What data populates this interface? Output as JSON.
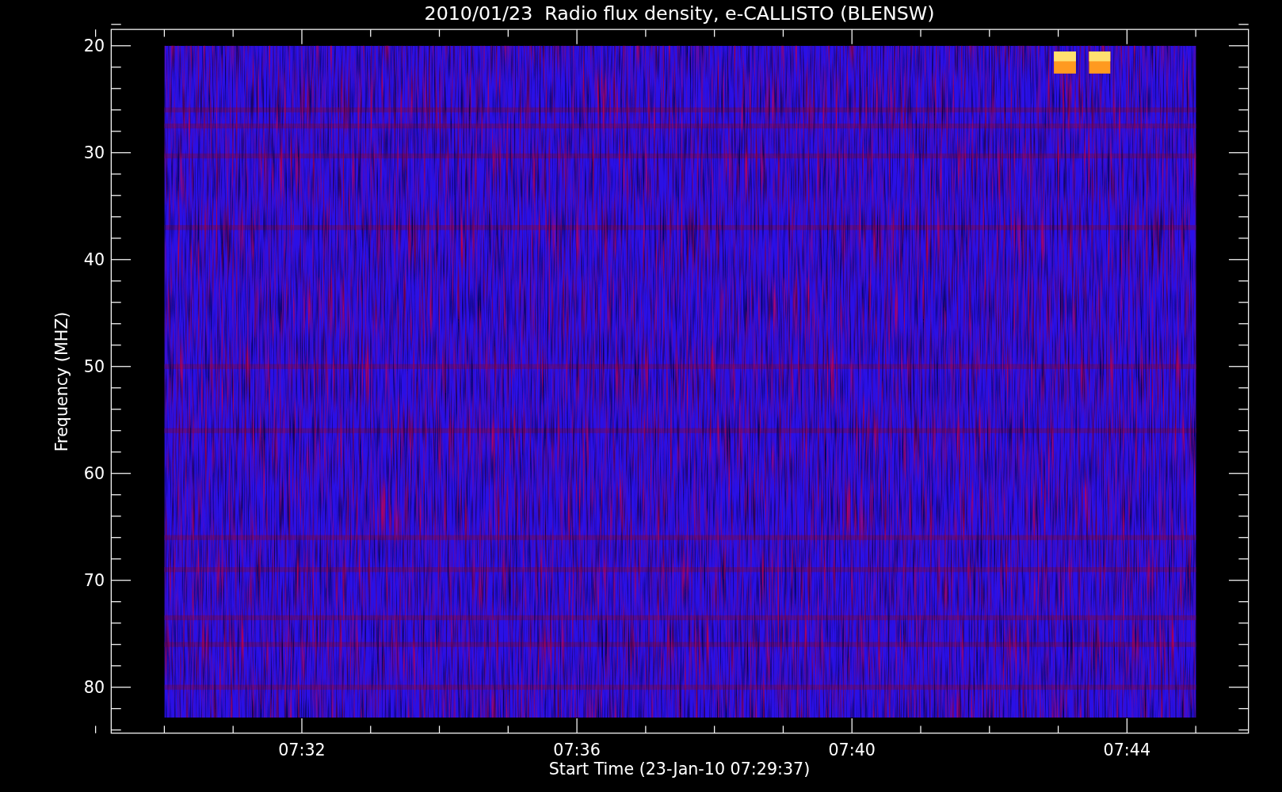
{
  "plot": {
    "title": "2010/01/23  Radio flux density, e-CALLISTO (BLENSW)",
    "x_axis_label": "Start Time (23-Jan-10 07:29:37)",
    "y_axis_label": "Frequency (MHZ)",
    "y_tick_labels": [
      "20",
      "30",
      "40",
      "50",
      "60",
      "70",
      "80"
    ],
    "x_tick_labels": [
      "07:32",
      "07:36",
      "07:40",
      "07:44"
    ]
  }
}
